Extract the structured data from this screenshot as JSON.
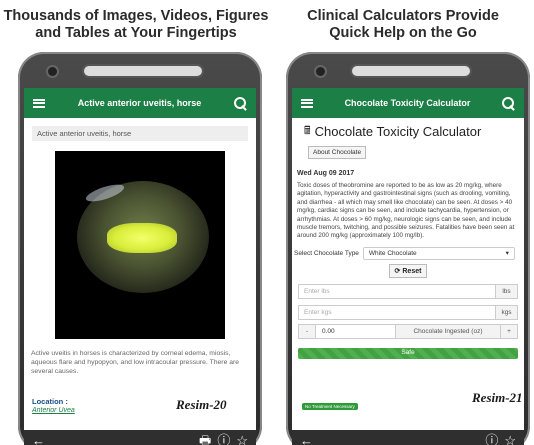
{
  "headlines": {
    "left": [
      "Thousands of Images, Videos, Figures",
      "and Tables at Your Fingertips"
    ],
    "right": [
      "Clinical Calculators Provide",
      "Quick Help on the Go"
    ]
  },
  "left_phone": {
    "appbar_title": "Active anterior uveitis, horse",
    "breadcrumb": "Active anterior uveitis, horse",
    "description": "Active uveitis in horses is characterized by corneal edema, miosis, aqueous flare and hypopyon, and low intracoular pressure. There are several causes.",
    "location_label": "Location :",
    "location_link": "Anterior Uvea",
    "figure_label": "Resim-20",
    "bottom_icons": {
      "back": "←",
      "print": "🖶",
      "info": "ⓘ",
      "star": "☆"
    }
  },
  "right_phone": {
    "appbar_title": "Chocolate Toxicity Calculator",
    "calc_title": "Chocolate Toxicity Calculator",
    "calc_icon": "calculator-icon",
    "about_button": "About Chocolate",
    "date": "Wed Aug 09 2017",
    "intro": "Toxic doses of theobromine are reported to be as low as 20 mg/kg, where agitation, hyperactivity and gastrointestinal signs (such as drooling, vomiting, and diarrhea - all which may smell like chocolate) can be seen. At doses > 40 mg/kg, cardiac signs can be seen, and include tachycardia, hypertension, or arrhythmias. At doses > 60 mg/kg, neurologic signs can be seen, and include muscle tremors, twitching, and possible seizures. Fatalities have been seen at around 200 mg/kg (approximately 100 mg/lb).",
    "select_label": "Select Chocolate Type",
    "select_value": "White Chocolate",
    "reset_button": "Reset",
    "lbs_placeholder": "Enter lbs",
    "lbs_unit": "lbs",
    "kgs_placeholder": "Enter kgs",
    "kgs_unit": "kgs",
    "minus": "-",
    "quantity": "0.00",
    "ingested_label": "Chocolate Ingested (oz)",
    "plus": "+",
    "progress_text": "Safe",
    "progress_fraction": 1.0,
    "badge": "No Treatment Necessary",
    "figure_label": "Resim-21",
    "bottom_icons": {
      "back": "←",
      "info": "ⓘ",
      "star": "☆"
    }
  },
  "colors": {
    "appbar": "#1c7f45",
    "bottombar": "#2f2f2f",
    "progress": "#4fb04f"
  }
}
